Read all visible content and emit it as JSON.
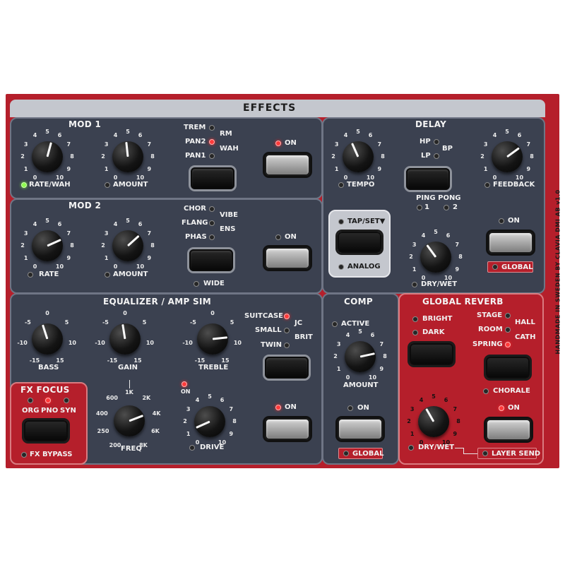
{
  "header": {
    "title": "EFFECTS"
  },
  "side_text": "HANDMADE IN SWEDEN BY CLAVIA DMI AB  v1.0",
  "mod1": {
    "title": "MOD 1",
    "rate_label": "RATE/WAH",
    "amount_label": "AMOUNT",
    "scale": [
      "0",
      "1",
      "2",
      "3",
      "4",
      "5",
      "6",
      "7",
      "8",
      "9",
      "10"
    ],
    "types": [
      "TREM",
      "PAN2",
      "PAN1",
      "RM",
      "WAH"
    ],
    "on_label": "ON"
  },
  "mod2": {
    "title": "MOD 2",
    "rate_label": "RATE",
    "amount_label": "AMOUNT",
    "types": [
      "CHOR",
      "FLANG",
      "PHAS",
      "VIBE",
      "ENS"
    ],
    "wide_label": "WIDE",
    "on_label": "ON"
  },
  "delay": {
    "title": "DELAY",
    "tempo_label": "TEMPO",
    "feedback_label": "FEEDBACK",
    "filters": [
      "HP",
      "LP",
      "BP"
    ],
    "ping_pong_label": "PING PONG",
    "ping_pong_options": [
      "1",
      "2"
    ],
    "tap_set_label": "TAP/SET▼",
    "analog_label": "ANALOG",
    "dry_wet_label": "DRY/WET",
    "on_label": "ON",
    "global_label": "GLOBAL"
  },
  "eq": {
    "title": "EQUALIZER / AMP SIM",
    "bass_label": "BASS",
    "gain_label": "GAIN",
    "treble_label": "TREBLE",
    "scale": [
      "-15",
      "-10",
      "-5",
      "0",
      "5",
      "10",
      "15"
    ],
    "amps": [
      "SUITCASE",
      "SMALL",
      "TWIN",
      "JC",
      "BRIT"
    ],
    "freq_label": "FREQ",
    "freq_scale": [
      "200",
      "250",
      "400",
      "600",
      "1K",
      "2K",
      "4K",
      "6K",
      "8K"
    ],
    "drive_label": "DRIVE",
    "drive_on_label": "ON",
    "on_label": "ON"
  },
  "fx_focus": {
    "title": "FX FOCUS",
    "options": [
      "ORG",
      "PNO",
      "SYN"
    ],
    "bypass_label": "FX BYPASS"
  },
  "comp": {
    "title": "COMP",
    "active_label": "ACTIVE",
    "amount_label": "AMOUNT",
    "scale": [
      "0",
      "1",
      "2",
      "3",
      "4",
      "5",
      "6",
      "7",
      "8",
      "9",
      "10"
    ],
    "on_label": "ON",
    "global_label": "GLOBAL"
  },
  "reverb": {
    "title": "GLOBAL REVERB",
    "options": [
      "BRIGHT",
      "DARK"
    ],
    "types": [
      "STAGE",
      "ROOM",
      "SPRING",
      "HALL",
      "CATH"
    ],
    "chorale_label": "CHORALE",
    "on_label": "ON",
    "dry_wet_label": "DRY/WET",
    "layer_send_label": "LAYER SEND"
  },
  "knobs": {
    "mod1_rate": 0.55,
    "mod1_amount": 0.48,
    "mod2_rate": 0.72,
    "mod2_amount": 0.66,
    "delay_tempo": 0.42,
    "delay_feedback": 0.68,
    "delay_dry_wet": 0.38,
    "eq_bass": 0.44,
    "eq_gain": 0.47,
    "eq_treble": 0.78,
    "eq_freq": 0.73,
    "eq_drive": 0.12,
    "comp_amount": 0.76,
    "reverb_dry_wet": 0.4
  },
  "leds": {
    "mod1_rate": "green",
    "mod1_amount": "off",
    "mod1_trem": "off",
    "mod1_pan2": "red",
    "mod1_pan1": "off",
    "mod1_on": "red",
    "mod2_rate": "off",
    "mod2_amount": "off",
    "mod2_chor": "off",
    "mod2_flang": "off",
    "mod2_phas": "off",
    "mod2_wide": "off",
    "mod2_on": "off",
    "delay_tempo": "off",
    "delay_feedback": "off",
    "delay_hp": "off",
    "delay_lp": "off",
    "delay_pp1": "off",
    "delay_pp2": "off",
    "delay_tapset": "off",
    "delay_analog": "off",
    "delay_drywet": "off",
    "delay_on": "off",
    "delay_global": "off",
    "eq_suitcase": "red",
    "eq_small": "off",
    "eq_twin": "off",
    "eq_drive_on": "red",
    "eq_drive": "off",
    "eq_on": "red",
    "fx_org": "off",
    "fx_pno": "red",
    "fx_syn": "off",
    "fx_bypass": "off",
    "comp_active": "off",
    "comp_on": "off",
    "comp_global": "off",
    "rev_bright": "off",
    "rev_dark": "off",
    "rev_stage": "off",
    "rev_room": "off",
    "rev_spring": "red",
    "rev_chorale": "off",
    "rev_on": "red",
    "rev_drywet": "off",
    "rev_layersend": "off"
  }
}
